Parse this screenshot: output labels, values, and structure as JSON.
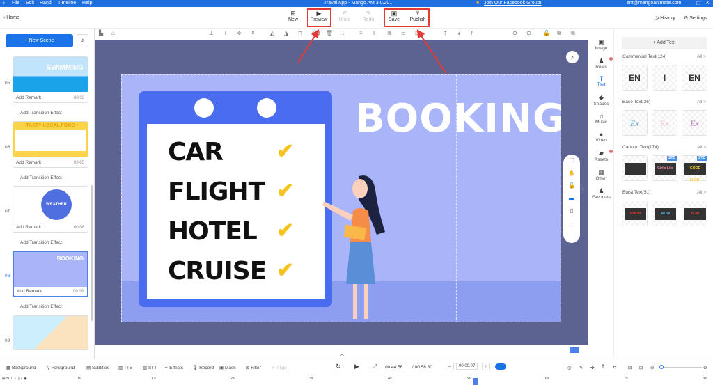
{
  "menu": [
    "File",
    "Edit",
    "Hand",
    "Timeline",
    "Help"
  ],
  "window_title": "Travel App - Mango AM 3.0.201",
  "facebook_link": "Join Our Facebook Group!",
  "account": "ent@mangoanimate.com",
  "window_controls": [
    "–",
    "❐",
    "X"
  ],
  "home": "Home",
  "toolbar": {
    "new": "New",
    "preview": "Preview",
    "undo": "Undo",
    "redo": "Redo",
    "save": "Save",
    "publish": "Publish",
    "history": "History",
    "settings": "Settings"
  },
  "new_scene": "+ New Scene",
  "scenes": [
    {
      "num": "05",
      "remark": "Add Remark",
      "duration": "00:03",
      "thumb_text": "SWIMMING"
    },
    {
      "num": "06",
      "remark": "Add Remark",
      "duration": "00:05",
      "thumb_text": "TASTY LOCAL FOOD"
    },
    {
      "num": "07",
      "remark": "Add Remark",
      "duration": "00:08",
      "thumb_text": "WEATHER"
    },
    {
      "num": "08",
      "remark": "Add Remark",
      "duration": "00:08",
      "thumb_text": "BOOKING"
    },
    {
      "num": "09"
    }
  ],
  "transition": "Add Transition Effect",
  "slide": {
    "title": "BOOKING",
    "items": [
      "CAR",
      "FLIGHT",
      "HOTEL",
      "CRUISE"
    ]
  },
  "right_tabs": [
    "Image",
    "Roles",
    "Text",
    "Shapes",
    "Music",
    "Video",
    "Assets",
    "Other",
    "Favorites"
  ],
  "add_text": "+ Add Text",
  "all_label": "All >",
  "categories": [
    {
      "name": "Commercial Text(124)",
      "samples": [
        "EN",
        "I",
        "EN"
      ]
    },
    {
      "name": "Base Text(26)",
      "samples": [
        "Ex",
        "Ex",
        "Ex"
      ]
    },
    {
      "name": "Cartoon Text(174)",
      "samples": [
        "",
        "Girl's Life",
        "GOOD LUCK!"
      ],
      "badge": "STD"
    },
    {
      "name": "Burst Text(51)",
      "samples": [
        "BOOM",
        "WOW",
        "POW"
      ]
    }
  ],
  "bottom": {
    "items": [
      "Background",
      "Foreground",
      "Subtitles",
      "TTS",
      "STT",
      "Effects",
      "Record",
      "Mask",
      "Filter",
      "Align"
    ],
    "current_time": "00:44.56",
    "total_time": "/ 00:58.80",
    "step": "00:00.07",
    "minus": "–",
    "plus": "+"
  },
  "timeline_ticks": [
    "0s",
    "1s",
    "2s",
    "3s",
    "4s",
    "5s",
    "6s",
    "7s",
    "8s"
  ],
  "colors": {
    "accent": "#1a73e8",
    "highlight": "#e53935",
    "board": "#4a6cf0",
    "check": "#f6c21c"
  }
}
